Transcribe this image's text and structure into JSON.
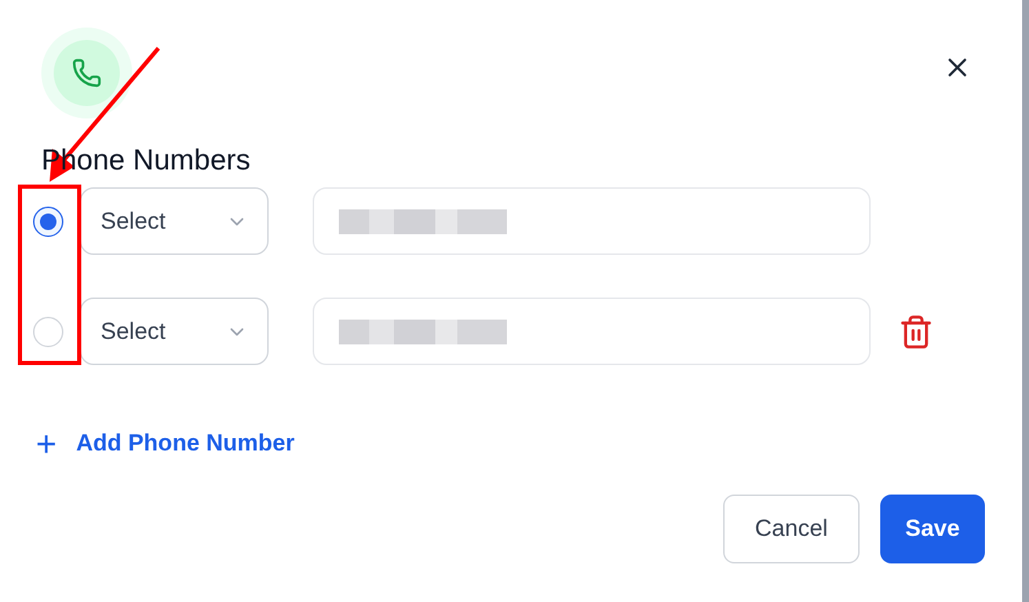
{
  "dialog": {
    "title": "Phone Numbers"
  },
  "phones": [
    {
      "selected": true,
      "type_placeholder": "Select",
      "deletable": false
    },
    {
      "selected": false,
      "type_placeholder": "Select",
      "deletable": true
    }
  ],
  "add_link": {
    "icon": "+",
    "label": "Add Phone Number"
  },
  "buttons": [
    {
      "kind": "secondary",
      "label": "Cancel"
    },
    {
      "kind": "primary",
      "label": "Save"
    }
  ]
}
